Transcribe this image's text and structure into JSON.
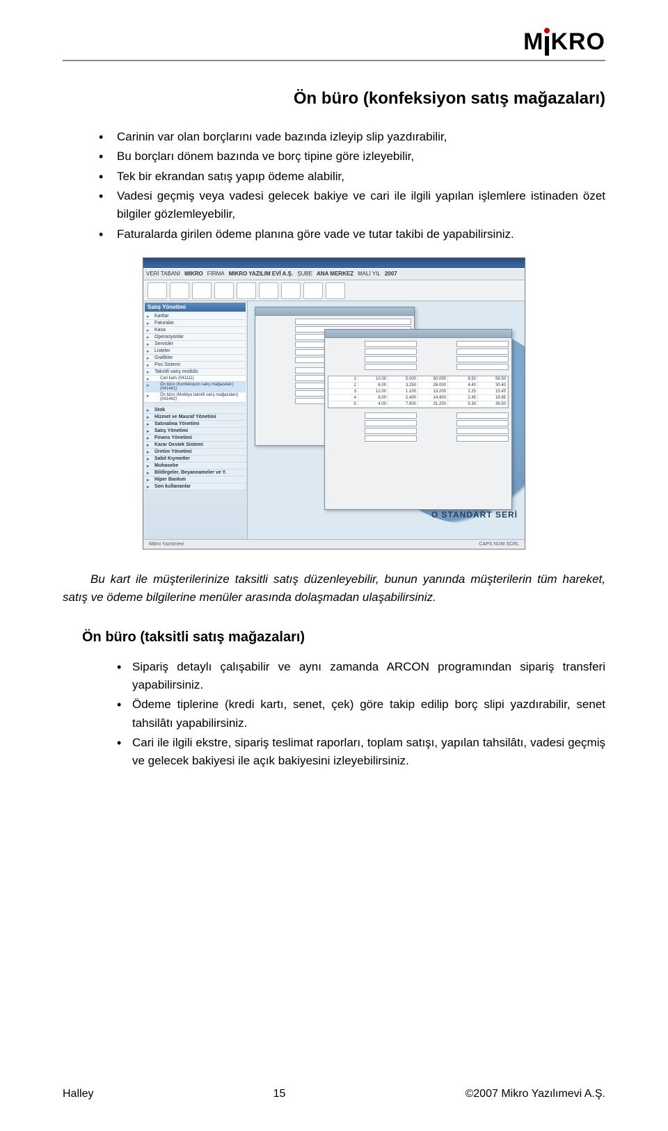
{
  "brand": "MiKRO",
  "title": "Ön büro (konfeksiyon satış mağazaları)",
  "bullets1": [
    "Carinin var olan borçlarını vade bazında izleyip slip yazdırabilir,",
    "Bu borçları dönem bazında ve borç tipine göre izleyebilir,",
    "Tek bir ekrandan satış yapıp ödeme alabilir,",
    "Vadesi geçmiş veya vadesi gelecek bakiye ve cari ile ilgili yapılan işlemlere istinaden özet bilgiler gözlemleyebilir,",
    "Faturalarda girilen ödeme planına göre vade ve tutar takibi de yapabilirsiniz."
  ],
  "paragraph1": "Bu kart ile müşterilerinize taksitli satış düzenleyebilir, bunun yanında müşterilerin tüm hareket, satış ve ödeme bilgilerine menüler arasında dolaşmadan ulaşabilirsiniz.",
  "subtitle": "Ön büro (taksitli satış mağazaları)",
  "bullets2": [
    "Sipariş detaylı çalışabilir ve aynı zamanda ARCON programından sipariş transferi yapabilirsiniz.",
    "Ödeme tiplerine (kredi kartı, senet, çek) göre takip edilip borç slipi yazdırabilir, senet tahsilâtı yapabilirsiniz.",
    "Cari ile ilgili ekstre, sipariş teslimat raporları, toplam satışı, yapılan tahsilâtı, vadesi geçmiş ve gelecek bakiyesi ile açık bakiyesini izleyebilirsiniz."
  ],
  "screenshot": {
    "toolbar_items": [
      "VERİ TABANI",
      "MIKRO",
      "FİRMA",
      "MIKRO YAZILIM EVİ A.Ş.",
      "ŞUBE",
      "ANA MERKEZ",
      "MALİ YIL",
      "2007"
    ],
    "side_header": "Satış Yönetimi",
    "side_items": [
      "Kartlar",
      "Faturalar",
      "Kasa",
      "Operasyonlar",
      "Servisler",
      "Listeler",
      "Grafikler",
      "Pos Sistemi",
      "Taksitli satış modülü"
    ],
    "side_subs": [
      "Cari kartı (041111)",
      "Ön büro (Konfeksiyon satış mağazaları) (041441)",
      "Ön büro (Mobilya taksitli satış mağazaları) (041442)"
    ],
    "side_groups": [
      "Stok",
      "Hizmet ve Masraf Yönetimi",
      "Satınalma Yönetimi",
      "Satış Yönetimi",
      "Finans Yönetimi",
      "Karar Destek Sistemi",
      "Üretim Yönetimi",
      "Sabit Kıymetler",
      "Muhasebe",
      "Bildirgeler, Beyannameler ve Y.",
      "Hiper Bankım",
      "Son kullananlar"
    ],
    "standart_seri_label": "O STANDART SERİ",
    "status_left": "Mikro Yazılımevi",
    "status_right": "CAPS NUM SCRL",
    "tbl_values": [
      [
        "1",
        "10.00",
        "5.000",
        "50.000",
        "8.50",
        "58.50"
      ],
      [
        "2",
        "8.00",
        "3.250",
        "26.000",
        "4.40",
        "30.40"
      ],
      [
        "3",
        "12.00",
        "1.100",
        "13.200",
        "2.25",
        "15.45"
      ],
      [
        "4",
        "6.00",
        "2.400",
        "14.400",
        "2.45",
        "16.85"
      ],
      [
        "5",
        "4.00",
        "7.800",
        "31.200",
        "5.30",
        "36.50"
      ]
    ]
  },
  "footer": {
    "left": "Halley",
    "page": "15",
    "right": "©2007 Mikro Yazılımevi A.Ş."
  }
}
